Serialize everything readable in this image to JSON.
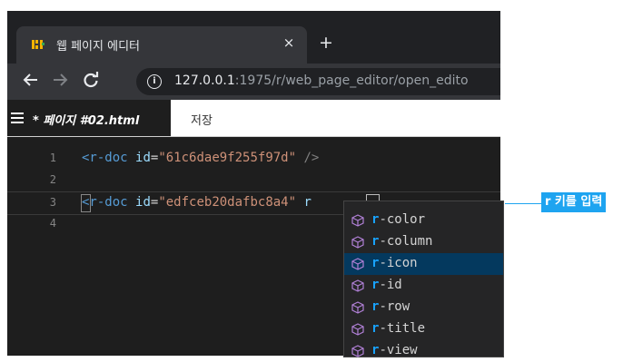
{
  "browser": {
    "tab_title": "웹 페이지 에디터",
    "tab_close": "×",
    "new_tab": "+",
    "url_host": "127.0.0.1",
    "url_path": ":1975/r/web_page_editor/open_edito"
  },
  "app": {
    "document_name": "* 페이지 #02.html",
    "save_label": "저장"
  },
  "editor": {
    "lines": [
      {
        "number": "1",
        "tag": "<r-doc",
        "attr": "id",
        "eq": "=",
        "value": "\"61c6dae9f255f97d\"",
        "tail": " />"
      },
      {
        "number": "2"
      },
      {
        "number": "3",
        "tag": "<r-doc",
        "attr": "id",
        "eq": "=",
        "value": "\"edfceb20dafbc8a4\"",
        "typed": "r"
      },
      {
        "number": "4"
      }
    ]
  },
  "suggestions": {
    "prefix": "r",
    "items": [
      "-color",
      "-column",
      "-icon",
      "-id",
      "-row",
      "-title",
      "-view"
    ],
    "selected_index": 2,
    "icon": "cube-icon"
  },
  "annotation": {
    "label": "r 키를 입력"
  },
  "colors": {
    "accent": "#1ea4f0",
    "editor_bg": "#1e1e1e",
    "suggest_selected": "#04395e",
    "match_text": "#18a3ff"
  }
}
